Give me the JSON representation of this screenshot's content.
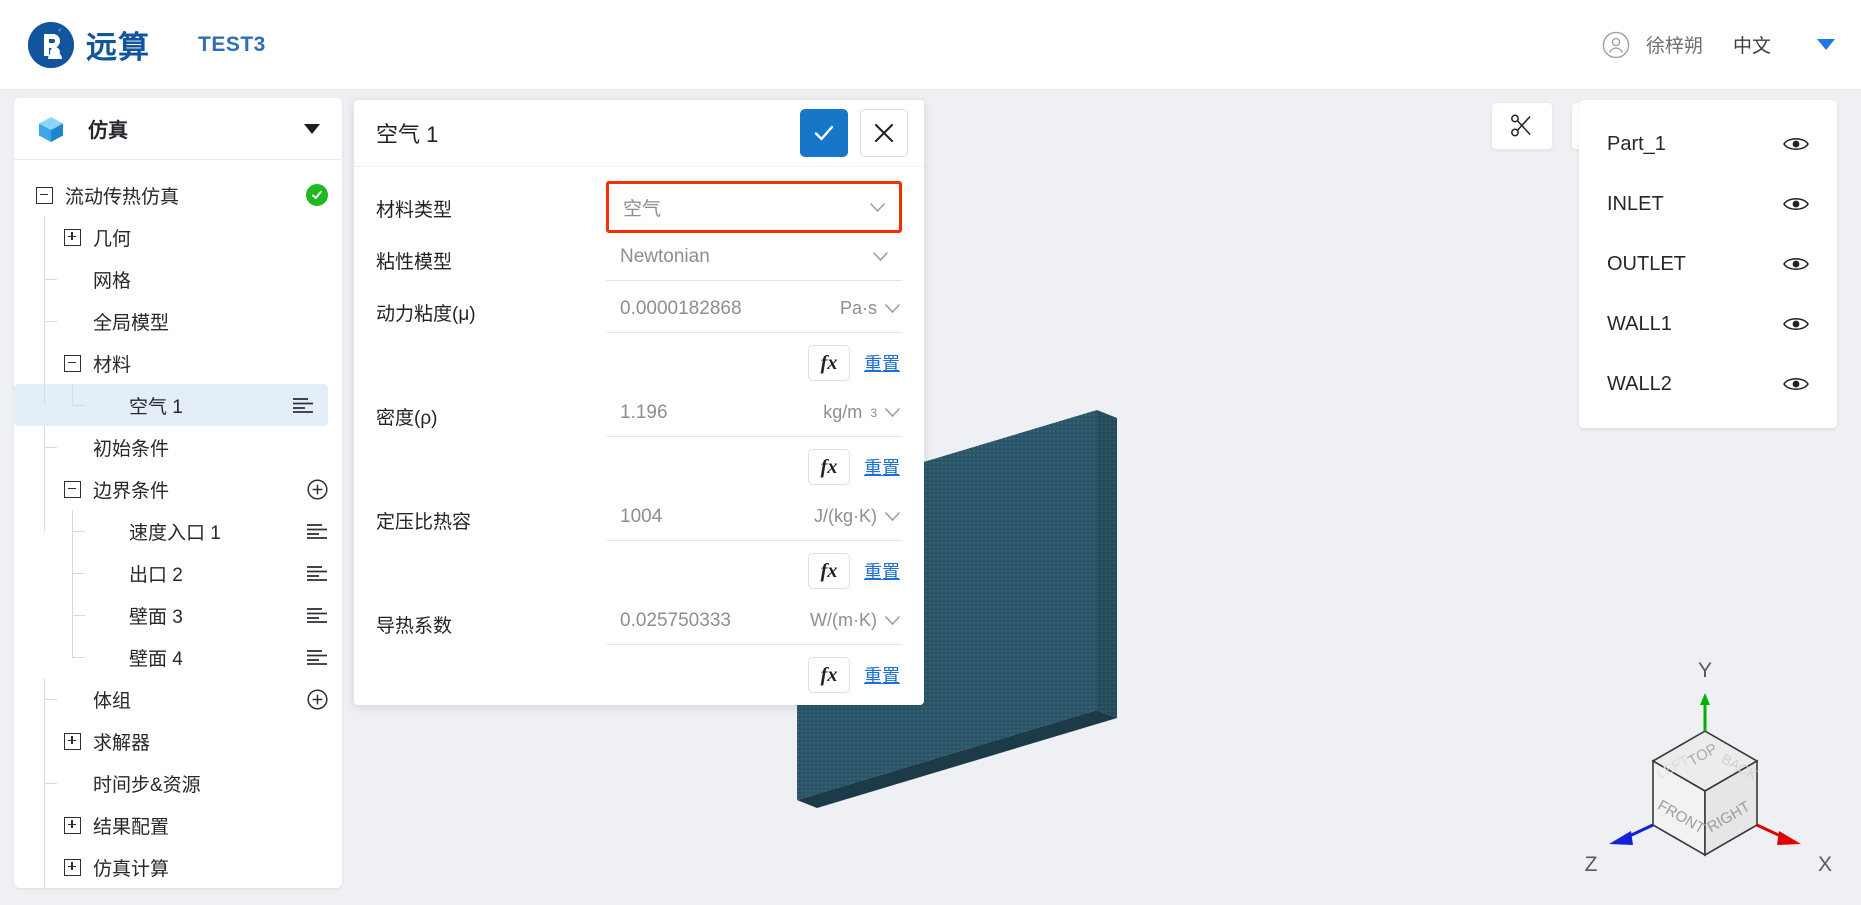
{
  "topbar": {
    "brand_name": "远算",
    "project_name": "TEST3",
    "user_name": "徐梓朔",
    "language": "中文",
    "avatar_icon": "user-circle-icon",
    "caret_icon": "caret-down-icon"
  },
  "sidebar": {
    "title": "仿真",
    "header_icon": "cube-icon",
    "collapse_icon": "caret-down-icon",
    "tree": [
      {
        "label": "流动传热仿真",
        "toggle": "minus",
        "depth": 0,
        "right": "status-ok"
      },
      {
        "label": "几何",
        "toggle": "plus",
        "depth": 1,
        "right": ""
      },
      {
        "label": "网格",
        "toggle": "none",
        "depth": 1,
        "right": ""
      },
      {
        "label": "全局模型",
        "toggle": "none",
        "depth": 1,
        "right": ""
      },
      {
        "label": "材料",
        "toggle": "minus",
        "depth": 1,
        "right": ""
      },
      {
        "label": "空气 1",
        "toggle": "none",
        "depth": 2,
        "right": "lines",
        "selected": true
      },
      {
        "label": "初始条件",
        "toggle": "none",
        "depth": 1,
        "right": ""
      },
      {
        "label": "边界条件",
        "toggle": "minus",
        "depth": 1,
        "right": "plus-circle"
      },
      {
        "label": "速度入口 1",
        "toggle": "none",
        "depth": 2,
        "right": "lines"
      },
      {
        "label": "出口 2",
        "toggle": "none",
        "depth": 2,
        "right": "lines"
      },
      {
        "label": "壁面 3",
        "toggle": "none",
        "depth": 2,
        "right": "lines"
      },
      {
        "label": "壁面 4",
        "toggle": "none",
        "depth": 2,
        "right": "lines"
      },
      {
        "label": "体组",
        "toggle": "none",
        "depth": 1,
        "right": "plus-circle"
      },
      {
        "label": "求解器",
        "toggle": "plus",
        "depth": 1,
        "right": ""
      },
      {
        "label": "时间步&资源",
        "toggle": "none",
        "depth": 1,
        "right": ""
      },
      {
        "label": "结果配置",
        "toggle": "plus",
        "depth": 1,
        "right": ""
      },
      {
        "label": "仿真计算",
        "toggle": "plus",
        "depth": 1,
        "right": ""
      }
    ]
  },
  "dialog": {
    "title": "空气 1",
    "confirm_icon": "check-icon",
    "cancel_icon": "close-icon",
    "fx_label": "fx",
    "reset_label": "重置",
    "chevron_icon": "chevron-down-icon",
    "fields": [
      {
        "label": "材料类型",
        "value": "空气",
        "unit": "",
        "kind": "select",
        "highlight": true,
        "has_fx": false
      },
      {
        "label": "粘性模型",
        "value": "Newtonian",
        "unit": "",
        "kind": "select",
        "highlight": false,
        "has_fx": false
      },
      {
        "label": "动力粘度(μ)",
        "value": "0.0000182868",
        "unit": "Pa·s",
        "unit_sup": "",
        "kind": "number",
        "highlight": false,
        "has_fx": true
      },
      {
        "label": "密度(ρ)",
        "value": "1.196",
        "unit": "kg/m",
        "unit_sup": "3",
        "kind": "number",
        "highlight": false,
        "has_fx": true
      },
      {
        "label": "定压比热容",
        "value": "1004",
        "unit": "J/(kg·K)",
        "unit_sup": "",
        "kind": "number",
        "highlight": false,
        "has_fx": true
      },
      {
        "label": "导热系数",
        "value": "0.025750333",
        "unit": "W/(m·K)",
        "unit_sup": "",
        "kind": "number",
        "highlight": false,
        "has_fx": true
      }
    ]
  },
  "viewport": {
    "tools": [
      {
        "icon": "scissors-icon",
        "name": "clip-button"
      },
      {
        "icon": "reset-view-icon",
        "name": "reset-view-button"
      }
    ],
    "parts": [
      {
        "label": "Part_1",
        "visible_icon": "eye-icon"
      },
      {
        "label": "INLET",
        "visible_icon": "eye-icon"
      },
      {
        "label": "OUTLET",
        "visible_icon": "eye-icon"
      },
      {
        "label": "WALL1",
        "visible_icon": "eye-icon"
      },
      {
        "label": "WALL2",
        "visible_icon": "eye-icon"
      }
    ],
    "axis_cube": {
      "faces": {
        "top": "TOP",
        "front": "FRONT",
        "right": "RIGHT",
        "left": "LEFT",
        "back": "BACK"
      },
      "axes": {
        "x": "X",
        "y": "Y",
        "z": "Z"
      },
      "axis_colors": {
        "x": "#e00000",
        "y": "#00b200",
        "z": "#1420d8"
      }
    },
    "geometry_color": "#2b5567"
  },
  "colors": {
    "brand": "#12559c",
    "accent": "#1876c8",
    "highlight_border": "#f53000",
    "status_ok": "#1fb81f",
    "link": "#1d6fd1"
  }
}
